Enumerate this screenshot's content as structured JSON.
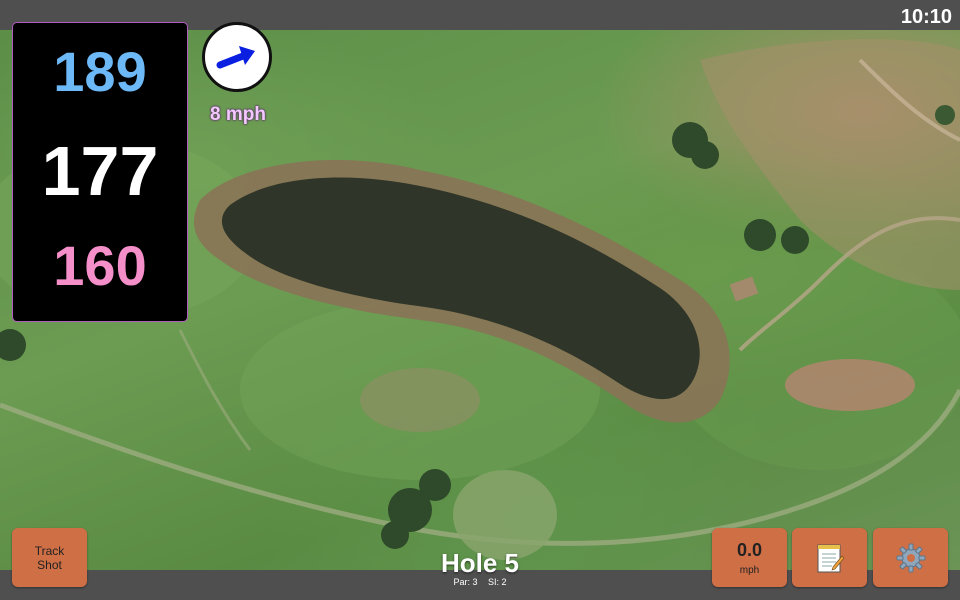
{
  "status_bar": {
    "time": "10:10"
  },
  "distances": {
    "back": "189",
    "middle": "177",
    "front": "160"
  },
  "wind": {
    "speed_label": "8 mph",
    "direction_icon": "wind-arrow-icon"
  },
  "hole": {
    "title": "Hole 5",
    "par": "Par: 3",
    "si": "SI: 2"
  },
  "buttons": {
    "track_shot": {
      "line1": "Track",
      "line2": "Shot"
    },
    "speed": {
      "value": "0.0",
      "unit": "mph"
    },
    "notes_icon": "notepad-icon",
    "settings_icon": "gear-icon"
  },
  "colors": {
    "back_distance": "#6db8f7",
    "middle_distance": "#ffffff",
    "front_distance": "#f58fc9",
    "button_bg": "#cf6f45",
    "bar_bg": "#4f4f4f"
  }
}
